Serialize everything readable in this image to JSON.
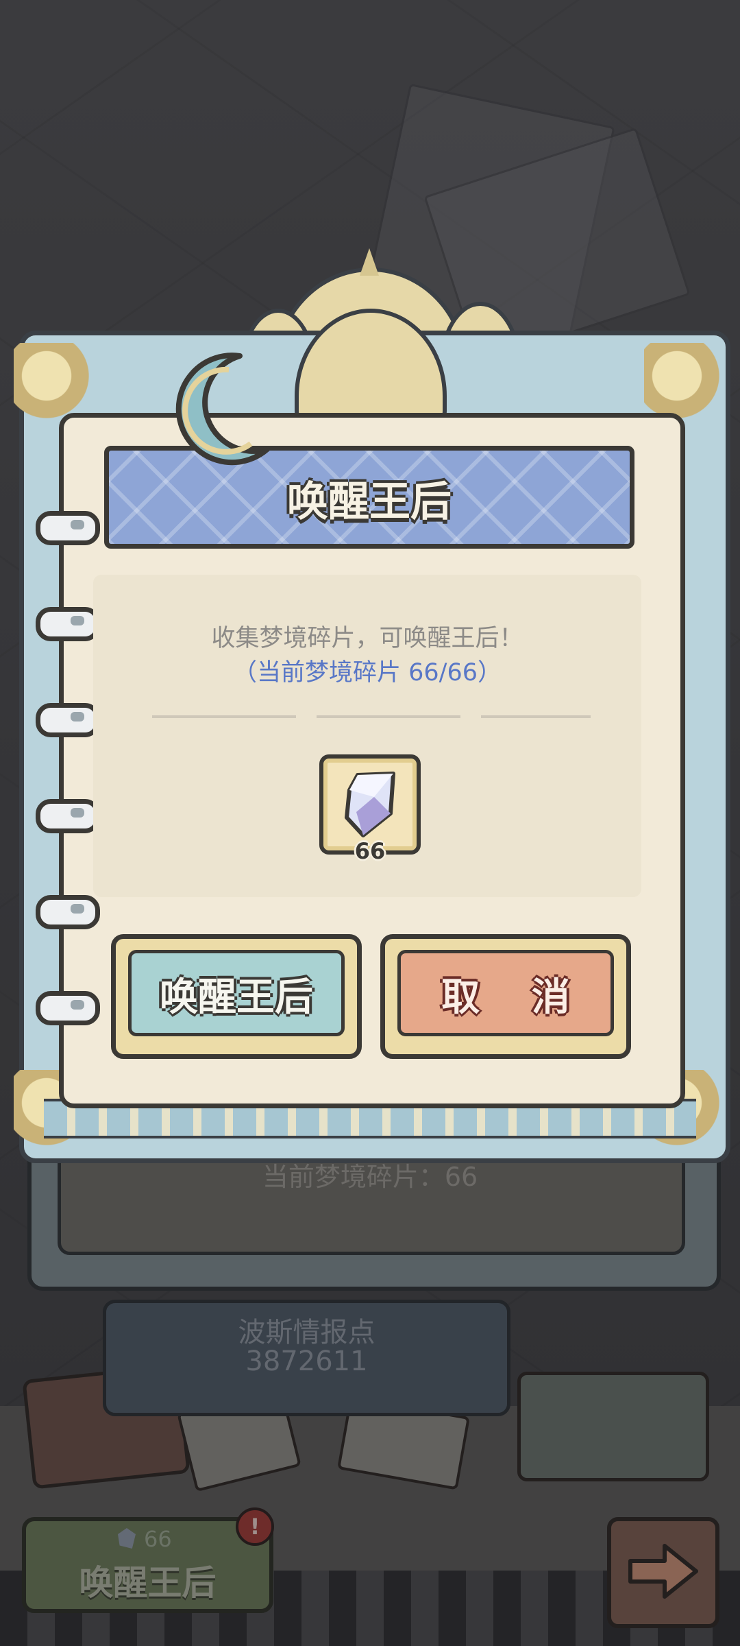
{
  "dialog": {
    "title": "唤醒王后",
    "description": "收集梦境碎片，可唤醒王后！",
    "progress": "（当前梦境碎片  66/66）",
    "item": {
      "icon": "dream-shard-icon",
      "count": "66"
    },
    "confirm_label": "唤醒王后",
    "cancel_label": "取 消"
  },
  "background": {
    "current_shards": "当前梦境碎片：66",
    "intel_label": "波斯情报点",
    "intel_value": "3872611",
    "awaken_button": {
      "count": "66",
      "label": "唤醒王后",
      "alert": "!"
    },
    "next_icon": "arrow-right-icon"
  },
  "colors": {
    "title_banner": "#8ea5d6",
    "progress_text": "#5877c7",
    "confirm_button": "#a9d2d2",
    "cancel_button": "#e6a88a",
    "paper": "#f2ead8"
  }
}
